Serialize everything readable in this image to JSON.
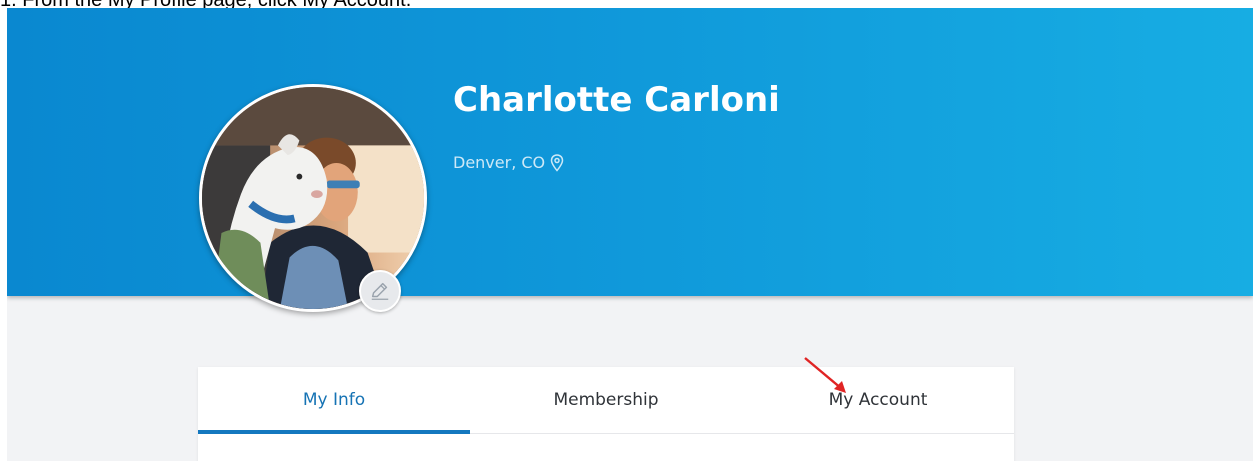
{
  "instruction": "1. From the My Profile page, click My Account.",
  "profile": {
    "name": "Charlotte Carloni",
    "location": "Denver, CO",
    "location_icon": "map-pin-icon",
    "avatar_alt": "profile photo",
    "edit_icon": "pencil-icon"
  },
  "tabs": [
    {
      "label": "My Info",
      "active": true
    },
    {
      "label": "Membership",
      "active": false
    },
    {
      "label": "My Account",
      "active": false
    }
  ],
  "colors": {
    "banner_start": "#0a88d0",
    "banner_end": "#17ade3",
    "active_tab": "#1478bf",
    "annotation_arrow": "#e02424"
  }
}
